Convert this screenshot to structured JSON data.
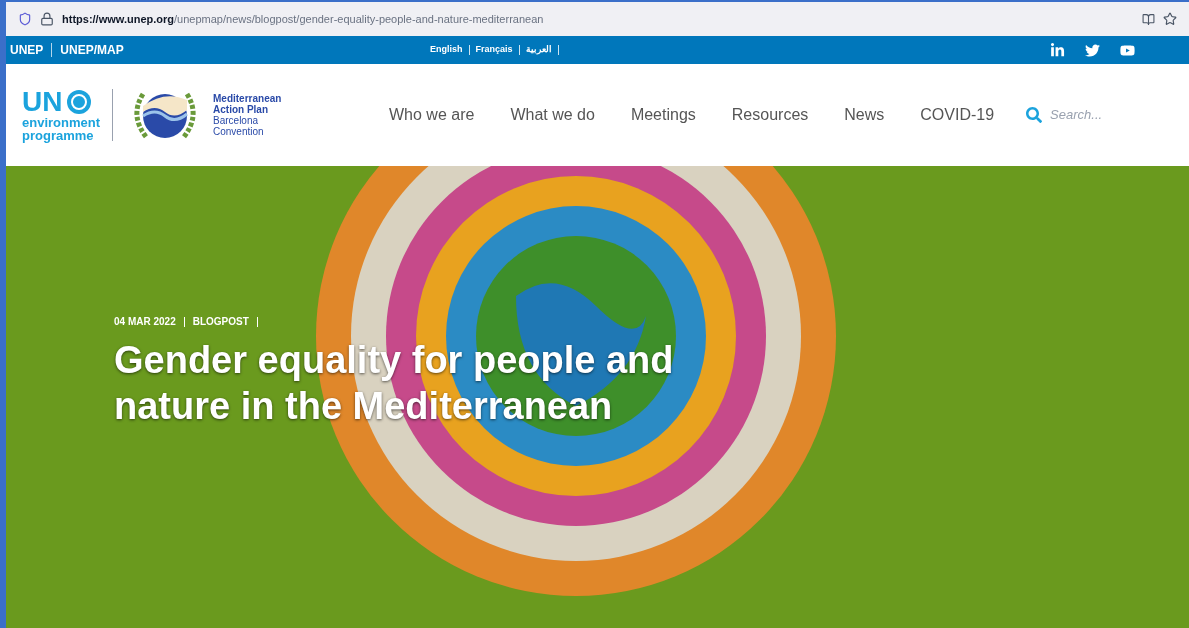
{
  "browser": {
    "url_domain": "https://www.unep.org",
    "url_path": "/unepmap/news/blogpost/gender-equality-people-and-nature-mediterranean"
  },
  "top_bar": {
    "links": [
      "UNEP",
      "UNEP/MAP"
    ],
    "languages": [
      "English",
      "Français",
      "العربية"
    ]
  },
  "header": {
    "logo_un": "UN",
    "logo_sub": [
      "environment",
      "programme"
    ],
    "map_title": [
      "Mediterranean",
      "Action Plan"
    ],
    "map_sub": [
      "Barcelona",
      "Convention"
    ],
    "nav": [
      "Who we are",
      "What we do",
      "Meetings",
      "Resources",
      "News",
      "COVID-19"
    ],
    "search": {
      "placeholder": "Search..."
    }
  },
  "hero": {
    "date": "04 MAR 2022",
    "category": "BLOGPOST",
    "title": "Gender equality for people and nature in the Mediterranean"
  }
}
